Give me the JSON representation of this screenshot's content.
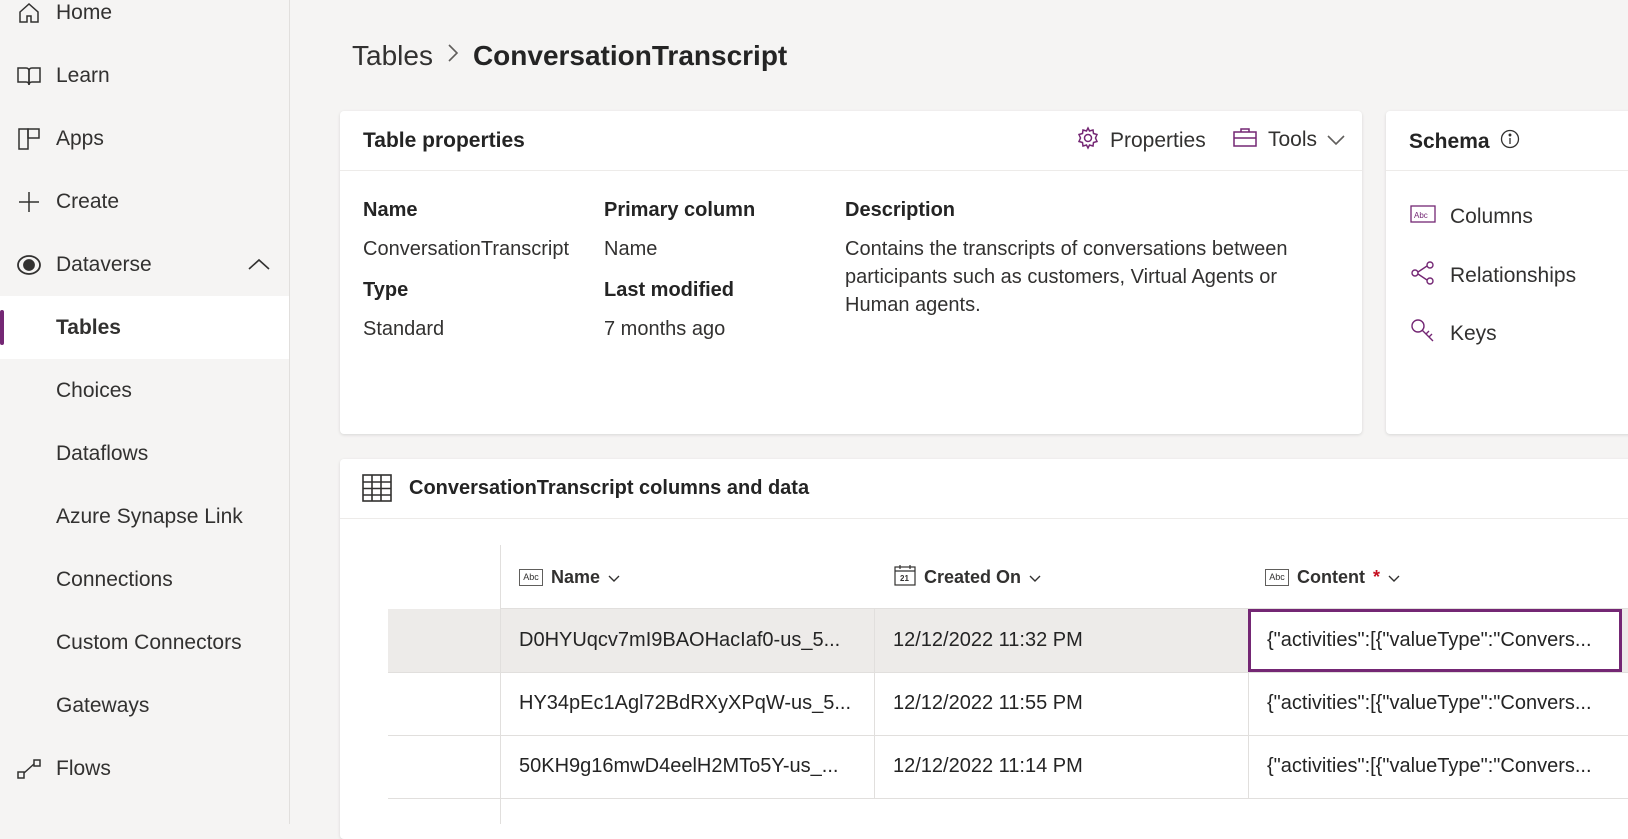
{
  "sidebar": {
    "items": [
      {
        "label": "Home",
        "icon": "home-icon"
      },
      {
        "label": "Learn",
        "icon": "book-icon"
      },
      {
        "label": "Apps",
        "icon": "apps-icon"
      },
      {
        "label": "Create",
        "icon": "plus-icon"
      },
      {
        "label": "Dataverse",
        "icon": "dataverse-icon"
      },
      {
        "label": "Tables"
      },
      {
        "label": "Choices"
      },
      {
        "label": "Dataflows"
      },
      {
        "label": "Azure Synapse Link"
      },
      {
        "label": "Connections"
      },
      {
        "label": "Custom Connectors"
      },
      {
        "label": "Gateways"
      },
      {
        "label": "Flows",
        "icon": "flow-icon"
      }
    ]
  },
  "breadcrumb": {
    "parent": "Tables",
    "current": "ConversationTranscript"
  },
  "table_properties": {
    "title": "Table properties",
    "properties_btn": "Properties",
    "tools_btn": "Tools",
    "name_label": "Name",
    "name_value": "ConversationTranscript",
    "type_label": "Type",
    "type_value": "Standard",
    "primary_label": "Primary column",
    "primary_value": "Name",
    "modified_label": "Last modified",
    "modified_value": "7 months ago",
    "desc_label": "Description",
    "desc_value": "Contains the transcripts of conversations between participants such as customers, Virtual Agents or Human agents."
  },
  "schema": {
    "title": "Schema",
    "items": [
      "Columns",
      "Relationships",
      "Keys"
    ]
  },
  "data_section": {
    "title": "ConversationTranscript columns and data",
    "columns": [
      {
        "label": "Name",
        "required": false
      },
      {
        "label": "Created On",
        "required": false
      },
      {
        "label": "Content",
        "required": true,
        "marker": "*"
      }
    ],
    "rows": [
      [
        "D0HYUqcv7mI9BAOHacIaf0-us_5...",
        "12/12/2022 11:32 PM",
        "{\"activities\":[{\"valueType\":\"Convers..."
      ],
      [
        "HY34pEc1Agl72BdRXyXPqW-us_5...",
        "12/12/2022 11:55 PM",
        "{\"activities\":[{\"valueType\":\"Convers..."
      ],
      [
        "50KH9g16mwD4eelH2MTo5Y-us_...",
        "12/12/2022 11:14 PM",
        "{\"activities\":[{\"valueType\":\"Convers..."
      ]
    ]
  },
  "colors": {
    "accent": "#742774",
    "required": "#c50f1f",
    "selected_row": "#edebe9"
  }
}
